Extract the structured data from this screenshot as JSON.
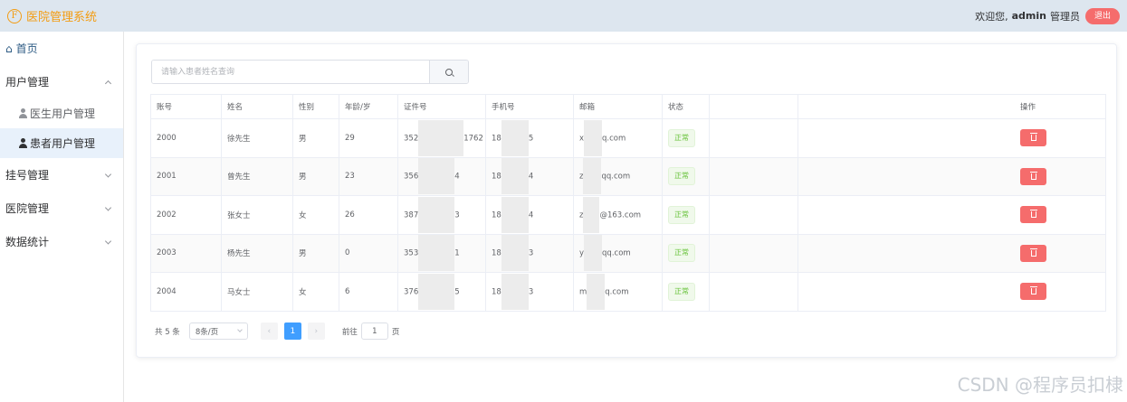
{
  "header": {
    "logo_letter": "F",
    "title": "医院管理系统",
    "welcome": "欢迎您,",
    "username": "admin",
    "role": "管理员",
    "logout_label": "退出"
  },
  "sidebar": {
    "home": "首页",
    "user_mgmt": "用户管理",
    "doctor_users": "医生用户管理",
    "patient_users": "患者用户管理",
    "registration_mgmt": "挂号管理",
    "hospital_mgmt": "医院管理",
    "statistics": "数据统计"
  },
  "search": {
    "placeholder": "请输入患者姓名查询"
  },
  "table": {
    "headers": {
      "account": "账号",
      "name": "姓名",
      "gender": "性别",
      "age": "年龄/岁",
      "id_card": "证件号",
      "phone": "手机号",
      "email": "邮箱",
      "status": "状态",
      "blank": "",
      "actions": "操作"
    },
    "rows": [
      {
        "account": "2000",
        "name": "徐先生",
        "gender": "男",
        "age": "29",
        "id_a": "352",
        "id_b": "1762",
        "phone_a": "18",
        "phone_b": "5",
        "email_a": "x",
        "email_b": "q.com",
        "status": "正常"
      },
      {
        "account": "2001",
        "name": "曾先生",
        "gender": "男",
        "age": "23",
        "id_a": "356",
        "id_b": "4",
        "phone_a": "18",
        "phone_b": "4",
        "email_a": "z",
        "email_b": "qq.com",
        "status": "正常"
      },
      {
        "account": "2002",
        "name": "张女士",
        "gender": "女",
        "age": "26",
        "id_a": "387",
        "id_b": "3",
        "phone_a": "18",
        "phone_b": "4",
        "email_a": "z",
        "email_b": "@163.com",
        "status": "正常"
      },
      {
        "account": "2003",
        "name": "杨先生",
        "gender": "男",
        "age": "0",
        "id_a": "353",
        "id_b": "1",
        "phone_a": "18",
        "phone_b": "3",
        "email_a": "y",
        "email_b": "qq.com",
        "status": "正常"
      },
      {
        "account": "2004",
        "name": "马女士",
        "gender": "女",
        "age": "6",
        "id_a": "376",
        "id_b": "5",
        "phone_a": "18",
        "phone_b": "3",
        "email_a": "m",
        "email_b": "q.com",
        "status": "正常"
      }
    ]
  },
  "pagination": {
    "total": "共 5 条",
    "page_size": "8条/页",
    "prev": "‹",
    "current": "1",
    "next": "›",
    "goto_prefix": "前往",
    "goto_value": "1",
    "goto_suffix": "页"
  },
  "watermark": "CSDN @程序员扣棣",
  "colors": {
    "brand": "#f39c12",
    "danger": "#f56c6c",
    "primary": "#409eff",
    "success": "#67c23a"
  }
}
